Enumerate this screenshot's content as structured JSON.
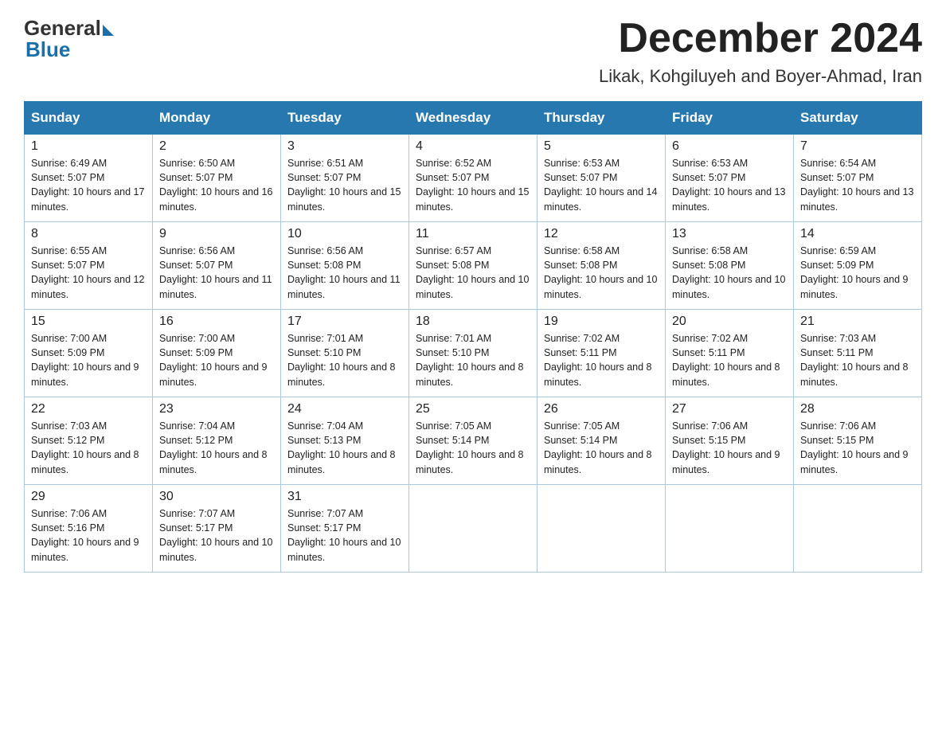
{
  "header": {
    "logo_general": "General",
    "logo_blue": "Blue",
    "month_title": "December 2024",
    "location": "Likak, Kohgiluyeh and Boyer-Ahmad, Iran"
  },
  "weekdays": [
    "Sunday",
    "Monday",
    "Tuesday",
    "Wednesday",
    "Thursday",
    "Friday",
    "Saturday"
  ],
  "weeks": [
    [
      {
        "day": "1",
        "sunrise": "6:49 AM",
        "sunset": "5:07 PM",
        "daylight": "10 hours and 17 minutes."
      },
      {
        "day": "2",
        "sunrise": "6:50 AM",
        "sunset": "5:07 PM",
        "daylight": "10 hours and 16 minutes."
      },
      {
        "day": "3",
        "sunrise": "6:51 AM",
        "sunset": "5:07 PM",
        "daylight": "10 hours and 15 minutes."
      },
      {
        "day": "4",
        "sunrise": "6:52 AM",
        "sunset": "5:07 PM",
        "daylight": "10 hours and 15 minutes."
      },
      {
        "day": "5",
        "sunrise": "6:53 AM",
        "sunset": "5:07 PM",
        "daylight": "10 hours and 14 minutes."
      },
      {
        "day": "6",
        "sunrise": "6:53 AM",
        "sunset": "5:07 PM",
        "daylight": "10 hours and 13 minutes."
      },
      {
        "day": "7",
        "sunrise": "6:54 AM",
        "sunset": "5:07 PM",
        "daylight": "10 hours and 13 minutes."
      }
    ],
    [
      {
        "day": "8",
        "sunrise": "6:55 AM",
        "sunset": "5:07 PM",
        "daylight": "10 hours and 12 minutes."
      },
      {
        "day": "9",
        "sunrise": "6:56 AM",
        "sunset": "5:07 PM",
        "daylight": "10 hours and 11 minutes."
      },
      {
        "day": "10",
        "sunrise": "6:56 AM",
        "sunset": "5:08 PM",
        "daylight": "10 hours and 11 minutes."
      },
      {
        "day": "11",
        "sunrise": "6:57 AM",
        "sunset": "5:08 PM",
        "daylight": "10 hours and 10 minutes."
      },
      {
        "day": "12",
        "sunrise": "6:58 AM",
        "sunset": "5:08 PM",
        "daylight": "10 hours and 10 minutes."
      },
      {
        "day": "13",
        "sunrise": "6:58 AM",
        "sunset": "5:08 PM",
        "daylight": "10 hours and 10 minutes."
      },
      {
        "day": "14",
        "sunrise": "6:59 AM",
        "sunset": "5:09 PM",
        "daylight": "10 hours and 9 minutes."
      }
    ],
    [
      {
        "day": "15",
        "sunrise": "7:00 AM",
        "sunset": "5:09 PM",
        "daylight": "10 hours and 9 minutes."
      },
      {
        "day": "16",
        "sunrise": "7:00 AM",
        "sunset": "5:09 PM",
        "daylight": "10 hours and 9 minutes."
      },
      {
        "day": "17",
        "sunrise": "7:01 AM",
        "sunset": "5:10 PM",
        "daylight": "10 hours and 8 minutes."
      },
      {
        "day": "18",
        "sunrise": "7:01 AM",
        "sunset": "5:10 PM",
        "daylight": "10 hours and 8 minutes."
      },
      {
        "day": "19",
        "sunrise": "7:02 AM",
        "sunset": "5:11 PM",
        "daylight": "10 hours and 8 minutes."
      },
      {
        "day": "20",
        "sunrise": "7:02 AM",
        "sunset": "5:11 PM",
        "daylight": "10 hours and 8 minutes."
      },
      {
        "day": "21",
        "sunrise": "7:03 AM",
        "sunset": "5:11 PM",
        "daylight": "10 hours and 8 minutes."
      }
    ],
    [
      {
        "day": "22",
        "sunrise": "7:03 AM",
        "sunset": "5:12 PM",
        "daylight": "10 hours and 8 minutes."
      },
      {
        "day": "23",
        "sunrise": "7:04 AM",
        "sunset": "5:12 PM",
        "daylight": "10 hours and 8 minutes."
      },
      {
        "day": "24",
        "sunrise": "7:04 AM",
        "sunset": "5:13 PM",
        "daylight": "10 hours and 8 minutes."
      },
      {
        "day": "25",
        "sunrise": "7:05 AM",
        "sunset": "5:14 PM",
        "daylight": "10 hours and 8 minutes."
      },
      {
        "day": "26",
        "sunrise": "7:05 AM",
        "sunset": "5:14 PM",
        "daylight": "10 hours and 8 minutes."
      },
      {
        "day": "27",
        "sunrise": "7:06 AM",
        "sunset": "5:15 PM",
        "daylight": "10 hours and 9 minutes."
      },
      {
        "day": "28",
        "sunrise": "7:06 AM",
        "sunset": "5:15 PM",
        "daylight": "10 hours and 9 minutes."
      }
    ],
    [
      {
        "day": "29",
        "sunrise": "7:06 AM",
        "sunset": "5:16 PM",
        "daylight": "10 hours and 9 minutes."
      },
      {
        "day": "30",
        "sunrise": "7:07 AM",
        "sunset": "5:17 PM",
        "daylight": "10 hours and 10 minutes."
      },
      {
        "day": "31",
        "sunrise": "7:07 AM",
        "sunset": "5:17 PM",
        "daylight": "10 hours and 10 minutes."
      },
      null,
      null,
      null,
      null
    ]
  ]
}
